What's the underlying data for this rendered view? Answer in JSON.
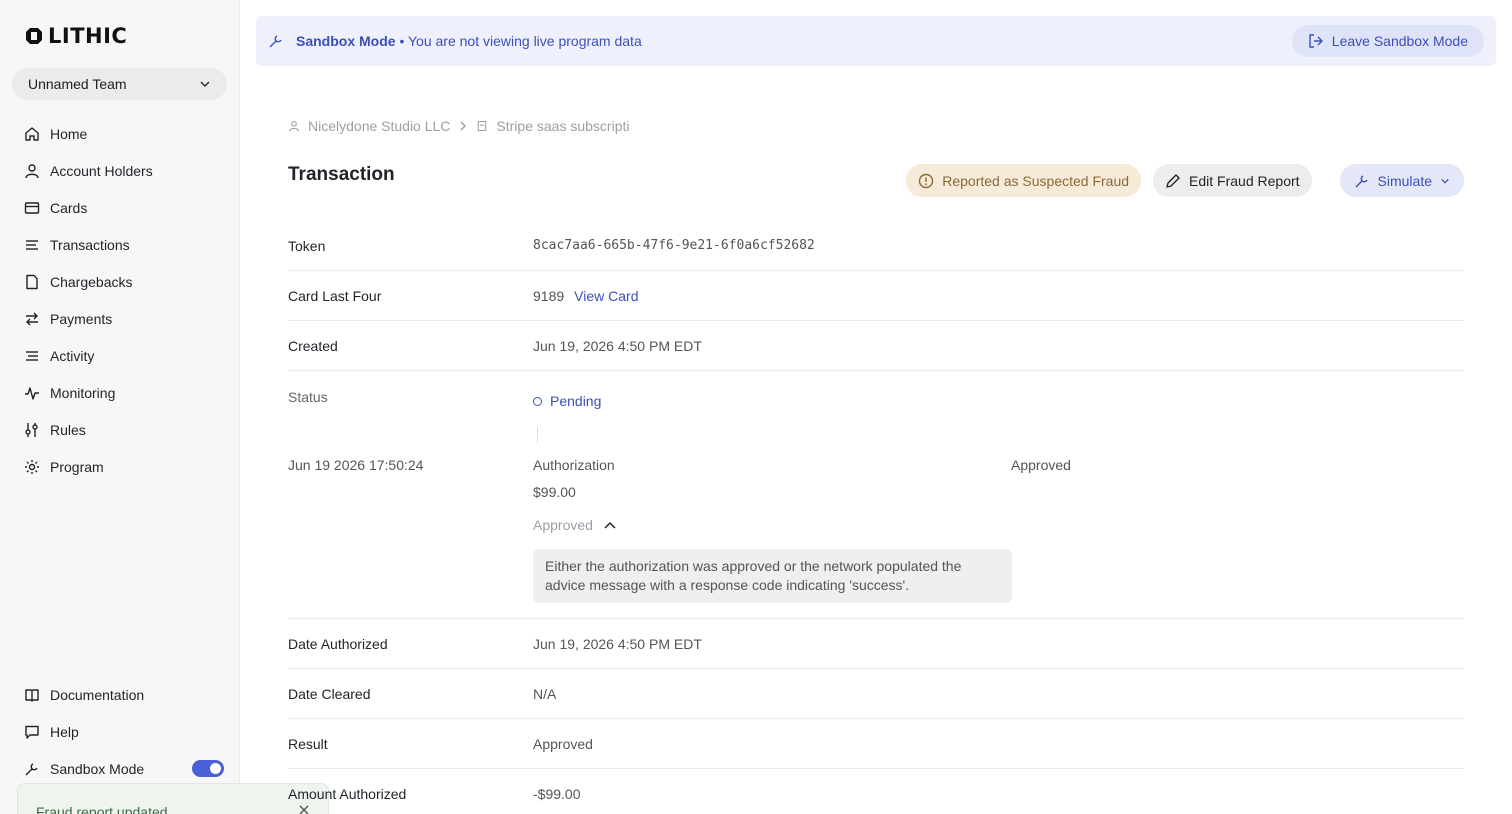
{
  "brand": {
    "logo_text": "LITHIC"
  },
  "team": {
    "name": "Unnamed Team"
  },
  "nav": [
    {
      "label": "Home",
      "icon": "home-icon"
    },
    {
      "label": "Account Holders",
      "icon": "user-icon"
    },
    {
      "label": "Cards",
      "icon": "card-icon"
    },
    {
      "label": "Transactions",
      "icon": "list-icon"
    },
    {
      "label": "Chargebacks",
      "icon": "file-icon"
    },
    {
      "label": "Payments",
      "icon": "swap-icon"
    },
    {
      "label": "Activity",
      "icon": "lines-icon"
    },
    {
      "label": "Monitoring",
      "icon": "pulse-icon"
    },
    {
      "label": "Rules",
      "icon": "sliders-icon"
    },
    {
      "label": "Program",
      "icon": "gear-icon"
    }
  ],
  "nav_bottom": {
    "documentation": "Documentation",
    "help": "Help",
    "sandbox": "Sandbox Mode"
  },
  "toast": {
    "message": "Fraud report updated"
  },
  "banner": {
    "mode": "Sandbox Mode",
    "separator": "•",
    "message": "You are not viewing live program data",
    "leave_label": "Leave Sandbox Mode"
  },
  "breadcrumb": {
    "account_holder": "Nicelydone Studio LLC",
    "merchant": "Stripe saas subscripti"
  },
  "page": {
    "title": "Transaction"
  },
  "actions": {
    "fraud_label": "Reported as Suspected Fraud",
    "edit_label": "Edit Fraud Report",
    "simulate_label": "Simulate"
  },
  "details": {
    "token_label": "Token",
    "token_value": "8cac7aa6-665b-47f6-9e21-6f0a6cf52682",
    "card_label": "Card Last Four",
    "card_value": "9189",
    "card_link": "View Card",
    "created_label": "Created",
    "created_value": "Jun 19, 2026 4:50 PM EDT",
    "status_label": "Status",
    "status_value": "Pending",
    "event": {
      "date": "Jun 19 2026 17:50:24",
      "type": "Authorization",
      "result": "Approved",
      "amount": "$99.00",
      "toggle_label": "Approved",
      "explanation": "Either the authorization was approved or the network populated the advice message with a response code indicating 'success'."
    },
    "authorized_label": "Date Authorized",
    "authorized_value": "Jun 19, 2026 4:50 PM EDT",
    "cleared_label": "Date Cleared",
    "cleared_value": "N/A",
    "result_label": "Result",
    "result_value": "Approved",
    "amount_auth_label": "Amount Authorized",
    "amount_auth_value": "-$99.00"
  },
  "colors": {
    "accent": "#3d4fb8",
    "toggle": "#4b5fd6",
    "fraud_bg": "#f6ead8"
  }
}
